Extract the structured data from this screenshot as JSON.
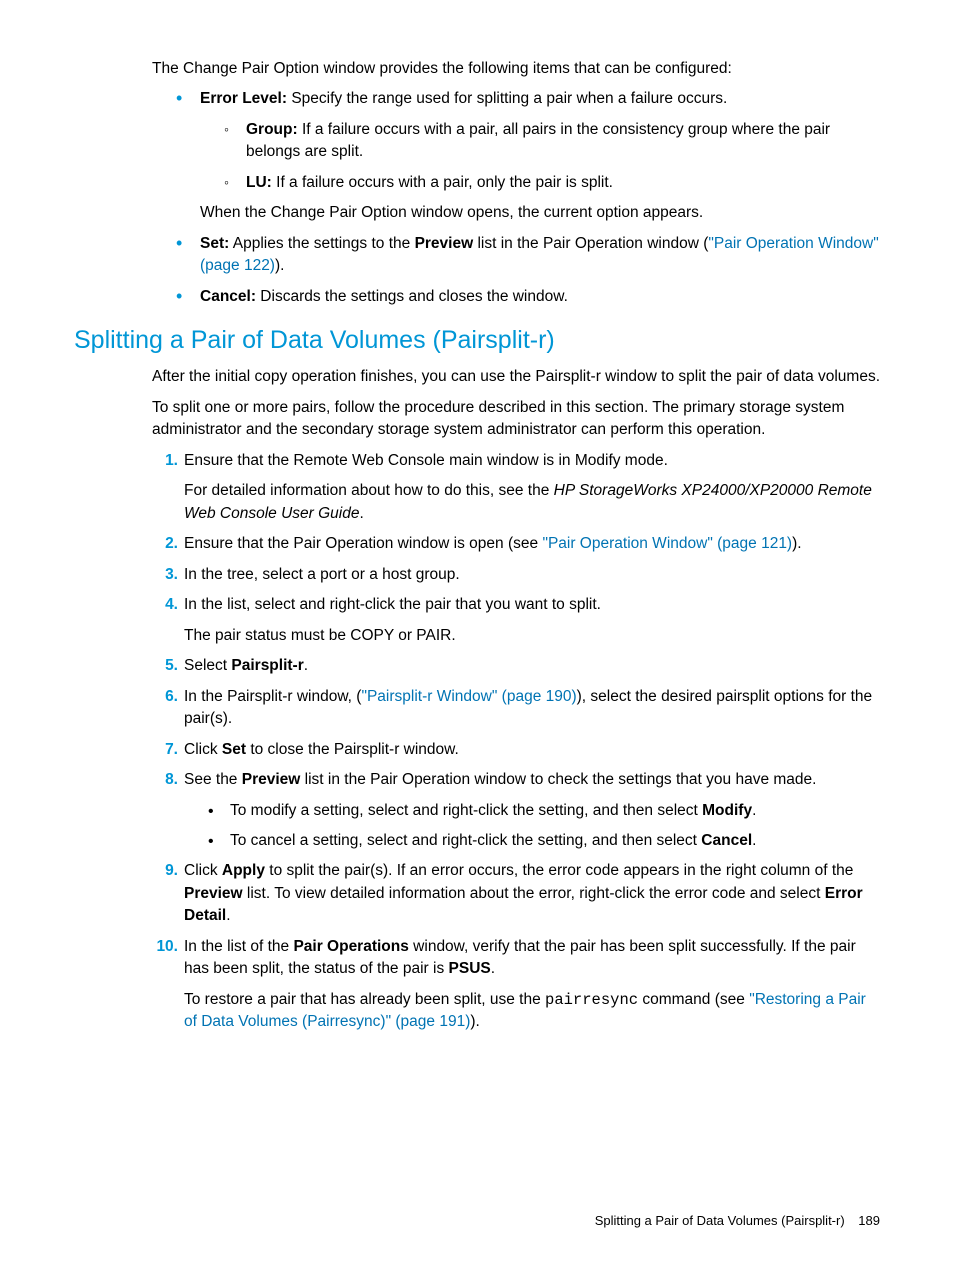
{
  "intro": "The Change Pair Option window provides the following items that can be configured:",
  "b1": {
    "label": "Error Level:",
    "text": " Specify the range used for splitting a pair when a failure occurs.",
    "sub1_label": "Group:",
    "sub1_text": " If a failure occurs with a pair, all pairs in the consistency group where the pair belongs are split.",
    "sub2_label": "LU:",
    "sub2_text": " If a failure occurs with a pair, only the pair is split.",
    "after": "When the Change Pair Option window opens, the current option appears."
  },
  "b2": {
    "label": "Set:",
    "text_a": " Applies the settings to the ",
    "text_b": "Preview",
    "text_c": " list in the Pair Operation window (",
    "link": "\"Pair Operation Window\" (page 122)",
    "text_d": ")."
  },
  "b3": {
    "label": "Cancel:",
    "text": " Discards the settings and closes the window."
  },
  "section_title": "Splitting a Pair of Data Volumes (Pairsplit-r)",
  "p_after": "After the initial copy operation finishes, you can use the Pairsplit-r window to split the pair of data volumes.",
  "p_tosplit": "To split one or more pairs, follow the procedure described in this section. The primary storage system administrator and the secondary storage system administrator can perform this operation.",
  "s1": {
    "n": "1.",
    "a": "Ensure that the Remote Web Console main window is in Modify mode.",
    "b1": "For detailed information about how to do this, see the ",
    "b2": "HP StorageWorks XP24000/XP20000 Remote Web Console User Guide",
    "b3": "."
  },
  "s2": {
    "n": "2.",
    "a": "Ensure that the Pair Operation window is open (see ",
    "link": "\"Pair Operation Window\" (page 121)",
    "b": ")."
  },
  "s3": {
    "n": "3.",
    "a": "In the tree, select a port or a host group."
  },
  "s4": {
    "n": "4.",
    "a": "In the list, select and right-click the pair that you want to split.",
    "b": "The pair status must be COPY or PAIR."
  },
  "s5": {
    "n": "5.",
    "a": "Select ",
    "b": "Pairsplit-r",
    "c": "."
  },
  "s6": {
    "n": "6.",
    "a": "In the Pairsplit-r window, (",
    "link": "\"Pairsplit-r Window\" (page 190)",
    "b": "), select the desired pairsplit options for the pair(s)."
  },
  "s7": {
    "n": "7.",
    "a": "Click ",
    "b": "Set",
    "c": " to close the Pairsplit-r window."
  },
  "s8": {
    "n": "8.",
    "a": "See the ",
    "b": "Preview",
    "c": " list in the Pair Operation window to check the settings that you have made.",
    "i1a": "To modify a setting, select and right-click the setting, and then select ",
    "i1b": "Modify",
    "i1c": ".",
    "i2a": "To cancel a setting, select and right-click the setting, and then select ",
    "i2b": "Cancel",
    "i2c": "."
  },
  "s9": {
    "n": "9.",
    "a": "Click ",
    "b": "Apply",
    "c": " to split the pair(s). If an error occurs, the error code appears in the right column of the ",
    "d": "Preview",
    "e": " list. To view detailed information about the error, right-click the error code and select ",
    "f": "Error Detail",
    "g": "."
  },
  "s10": {
    "n": "10.",
    "a": "In the list of the ",
    "b": "Pair Operations",
    "c": " window, verify that the pair has been split successfully. If the pair has been split, the status of the pair is ",
    "d": "PSUS",
    "e": ".",
    "p2a": "To restore a pair that has already been split, use the ",
    "p2b": "pairresync",
    "p2c": " command (see ",
    "p2link": "\"Restoring a Pair of Data Volumes (Pairresync)\" (page 191)",
    "p2d": ")."
  },
  "footer": {
    "title": "Splitting a Pair of Data Volumes (Pairsplit-r)",
    "page": "189"
  }
}
